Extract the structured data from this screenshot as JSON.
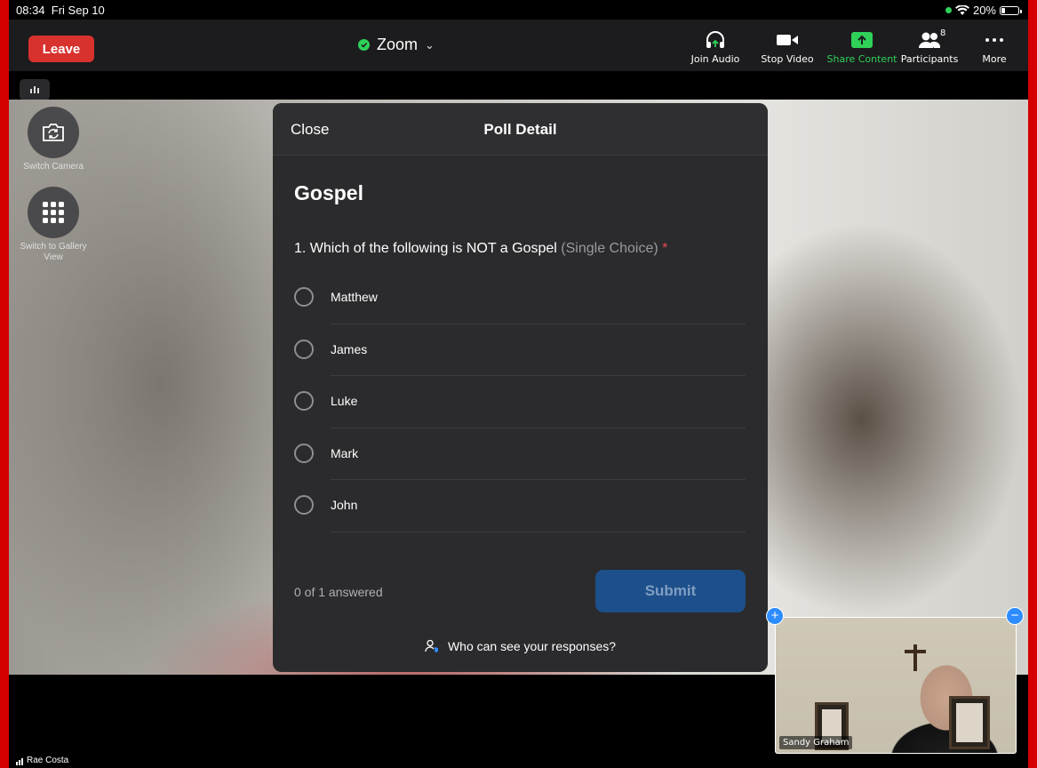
{
  "status_bar": {
    "time": "08:34",
    "date": "Fri Sep 10",
    "battery": "20%"
  },
  "toolbar": {
    "leave_label": "Leave",
    "meeting_title": "Zoom",
    "join_audio": "Join Audio",
    "stop_video": "Stop Video",
    "share_content": "Share Content",
    "participants": "Participants",
    "participant_count": "8",
    "more": "More"
  },
  "side": {
    "switch_camera": "Switch Camera",
    "switch_gallery": "Switch to Gallery View"
  },
  "poll": {
    "close_label": "Close",
    "header_title": "Poll Detail",
    "title": "Gospel",
    "question": "1. Which of the following is NOT a Gospel",
    "question_type": "(Single Choice)",
    "required_mark": "*",
    "options": [
      "Matthew",
      "James",
      "Luke",
      "Mark",
      "John"
    ],
    "answered": "0 of 1 answered",
    "submit_label": "Submit",
    "privacy_text": "Who can see your responses?"
  },
  "self_view": {
    "name": "Sandy Graham"
  },
  "speaker": {
    "name": "Rae Costa"
  },
  "colors": {
    "leave": "#d8322f",
    "accent_green": "#2fd158",
    "submit_disabled": "#1d4f8a",
    "required": "#e5484d"
  }
}
